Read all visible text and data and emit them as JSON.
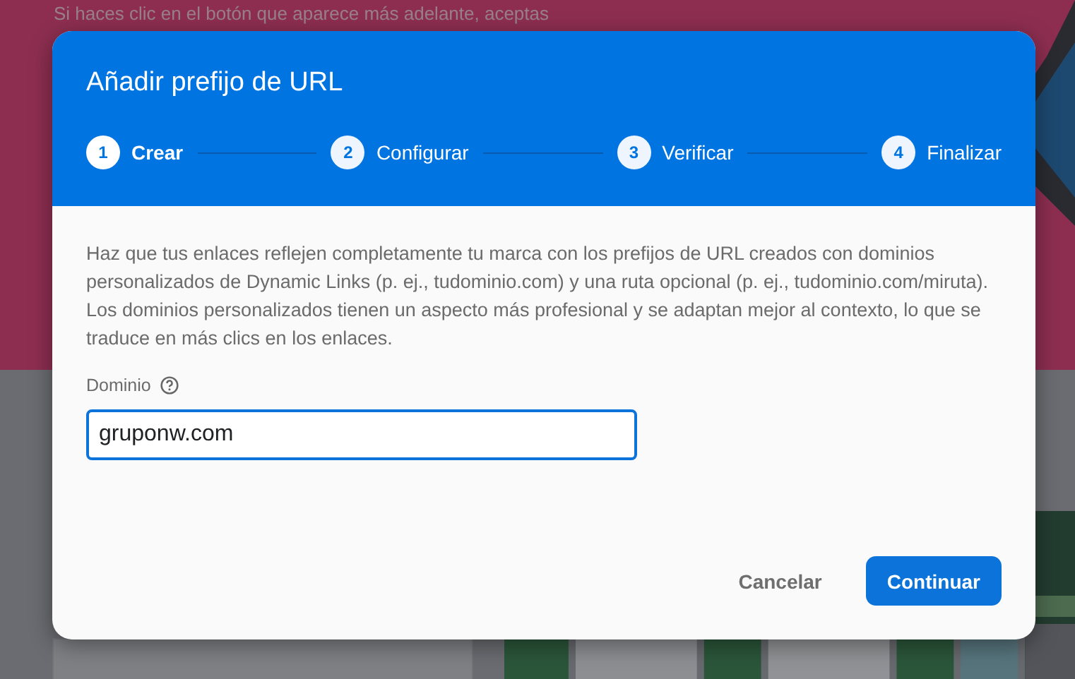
{
  "background": {
    "notice": "Si haces clic en el botón que aparece más adelante, aceptas"
  },
  "dialog": {
    "title": "Añadir prefijo de URL",
    "steps": [
      {
        "number": "1",
        "label": "Crear",
        "selected": true
      },
      {
        "number": "2",
        "label": "Configurar",
        "selected": false
      },
      {
        "number": "3",
        "label": "Verificar",
        "selected": false
      },
      {
        "number": "4",
        "label": "Finalizar",
        "selected": false
      }
    ],
    "description": "Haz que tus enlaces reflejen completamente tu marca con los prefijos de URL creados con dominios personalizados de Dynamic Links (p. ej., tudominio.com) y una ruta opcional (p. ej., tudominio.com/miruta). Los dominios personalizados tienen un aspecto más profesional y se adaptan mejor al contexto, lo que se traduce en más clics en los enlaces.",
    "field": {
      "label": "Dominio",
      "value": "gruponw.com"
    },
    "buttons": [
      {
        "label": "Cancelar",
        "kind": "text"
      },
      {
        "label": "Continuar",
        "kind": "primary"
      }
    ]
  }
}
